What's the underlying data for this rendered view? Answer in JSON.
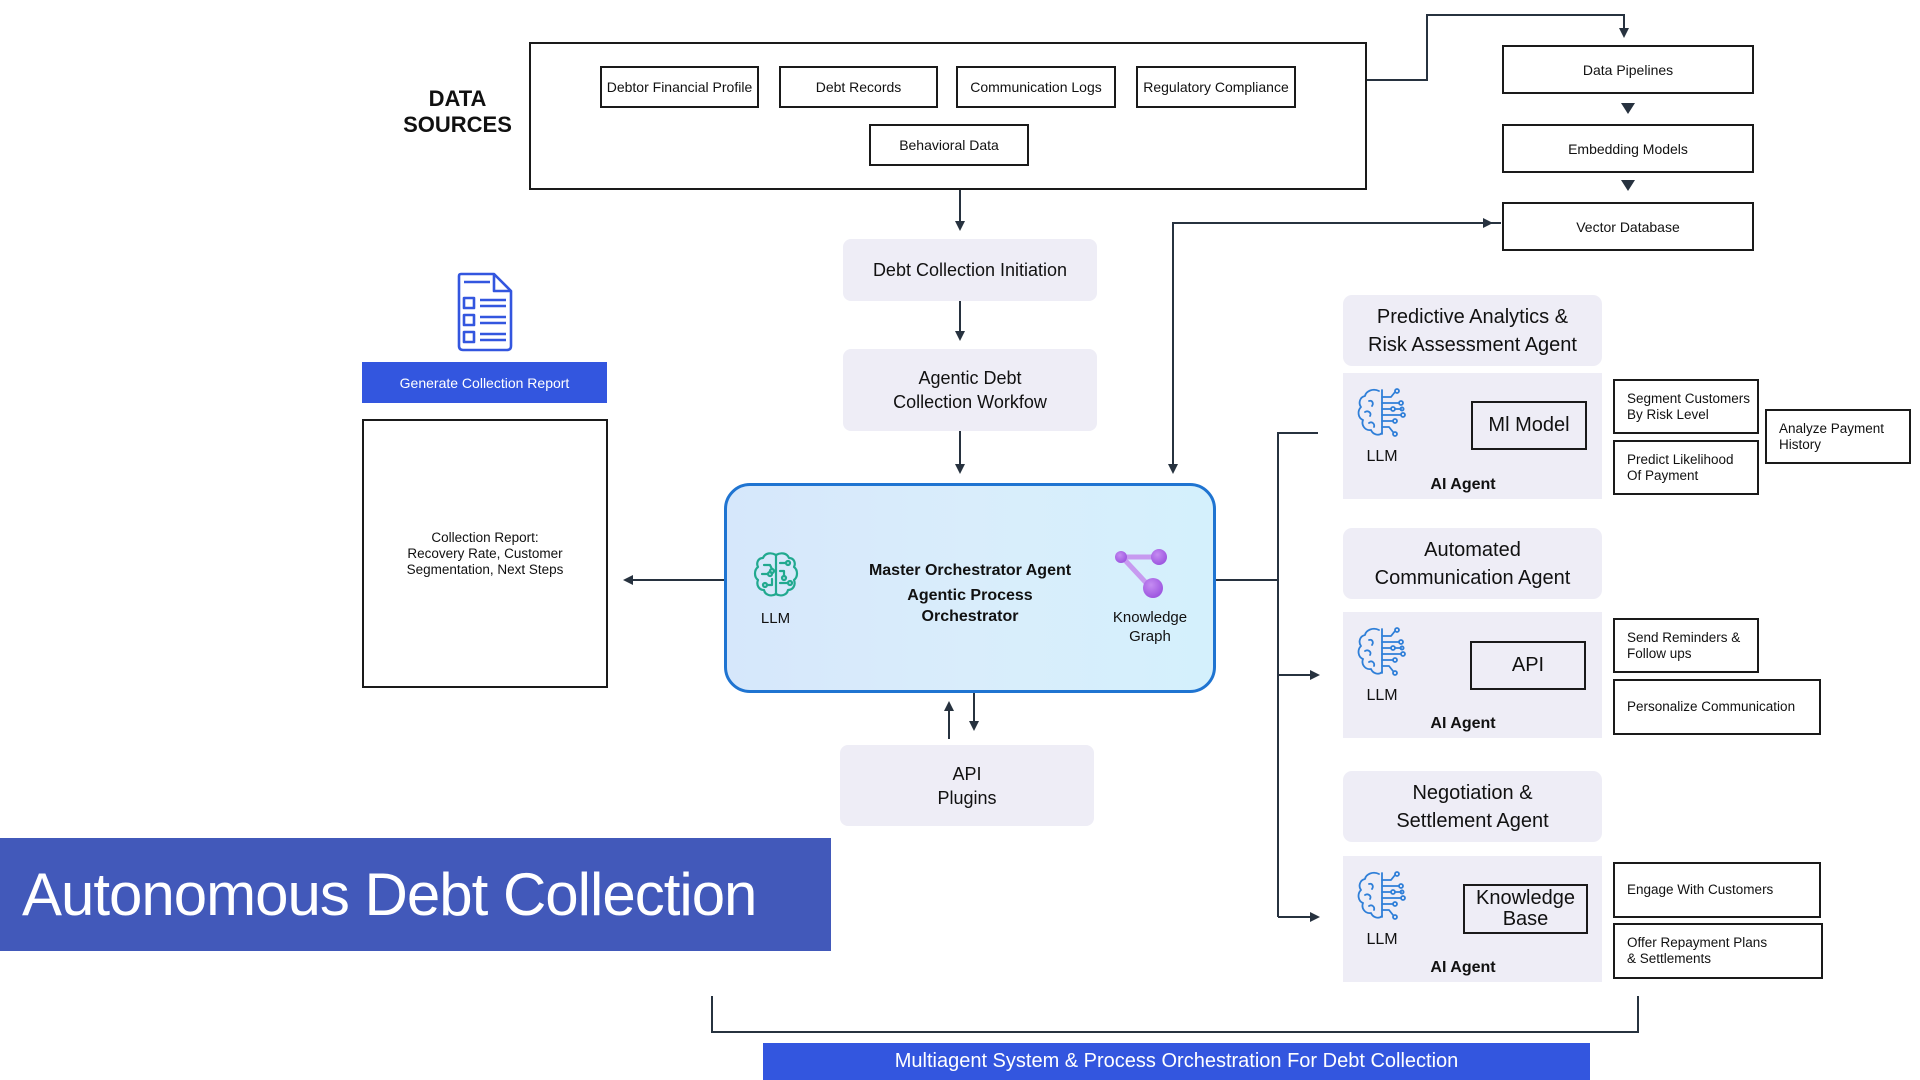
{
  "title": "Autonomous Debt Collection",
  "data_sources": {
    "label_line1": "DATA",
    "label_line2": "SOURCES",
    "items": [
      "Debtor Financial Profile",
      "Debt Records",
      "Communication Logs",
      "Regulatory Compliance",
      "Behavioral Data"
    ]
  },
  "pipeline": {
    "steps": [
      "Data Pipelines",
      "Embedding Models",
      "Vector Database"
    ]
  },
  "flow": {
    "initiation": "Debt Collection Initiation",
    "workflow_line1": "Agentic Debt",
    "workflow_line2": "Collection Workfow",
    "api_line1": "API",
    "api_line2": "Plugins"
  },
  "orchestrator": {
    "title": "Master Orchestrator Agent",
    "subtitle_line1": "Agentic Process",
    "subtitle_line2": "Orchestrator",
    "llm_label": "LLM",
    "kg_line1": "Knowledge",
    "kg_line2": "Graph"
  },
  "report": {
    "button_label": "Generate Collection Report",
    "line1": "Collection Report:",
    "line2": "Recovery Rate, Customer",
    "line3": "Segmentation, Next Steps"
  },
  "agents": [
    {
      "name_line1": "Predictive Analytics &",
      "name_line2": "Risk Assessment Agent",
      "llm_label": "LLM",
      "agent_label": "AI Agent",
      "tool_line1": "Ml Model",
      "tool_line2": "",
      "tasks": [
        {
          "line1": "Segment Customers",
          "line2": "By Risk Level"
        },
        {
          "line1": "Predict Likelihood",
          "line2": "Of Payment"
        },
        {
          "line1": "Analyze Payment",
          "line2": "History"
        }
      ]
    },
    {
      "name_line1": "Automated",
      "name_line2": "Communication Agent",
      "llm_label": "LLM",
      "agent_label": "AI Agent",
      "tool_line1": "API",
      "tool_line2": "",
      "tasks": [
        {
          "line1": "Send Reminders &",
          "line2": "Follow ups"
        },
        {
          "line1": "Personalize Communication",
          "line2": ""
        }
      ]
    },
    {
      "name_line1": "Negotiation &",
      "name_line2": "Settlement Agent",
      "llm_label": "LLM",
      "agent_label": "AI Agent",
      "tool_line1": "Knowledge",
      "tool_line2": "Base",
      "tasks": [
        {
          "line1": "Engage With Customers",
          "line2": ""
        },
        {
          "line1": "Offer Repayment Plans",
          "line2": "& Settlements"
        }
      ]
    }
  ],
  "footer": "Multiagent System & Process Orchestration For Debt Collection",
  "colors": {
    "connector": "#27323f",
    "orchestrator_border": "#1f74d1",
    "brand_blue": "#3356df",
    "banner_blue": "#4259ba",
    "llm_teal": "#21a98f",
    "agent_brain_blue": "#2f7fd8",
    "graph_purple": "#a35ee0",
    "box_fill": "#eeedf6"
  }
}
